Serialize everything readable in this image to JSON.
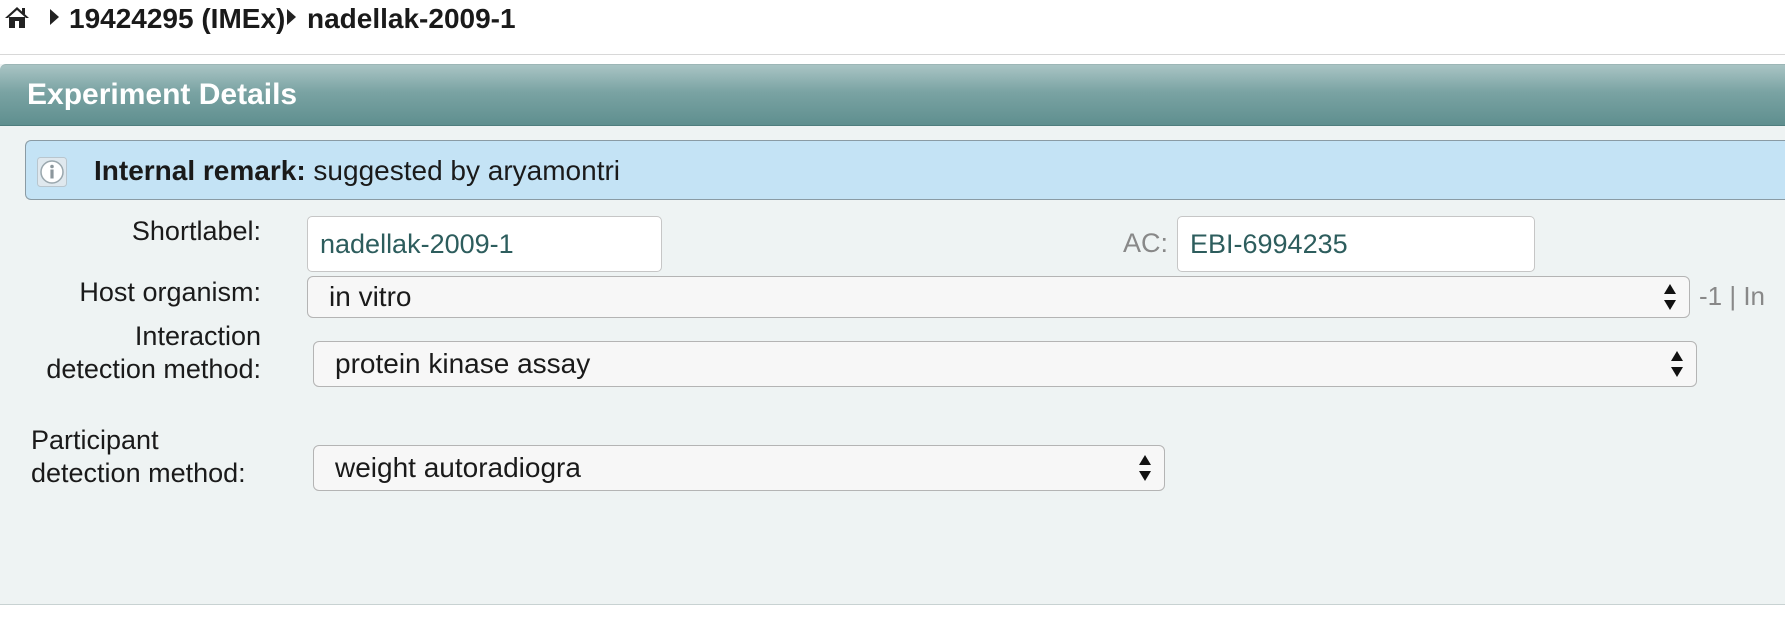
{
  "breadcrumb": {
    "home_icon": "home-icon",
    "items": [
      {
        "label": "19424295 (IMEx)"
      },
      {
        "label": "nadellak-2009-1"
      }
    ]
  },
  "panel": {
    "title": "Experiment Details",
    "remark": {
      "icon": "info-icon",
      "label": "Internal remark:",
      "text": "suggested by aryamontri"
    }
  },
  "form": {
    "shortlabel": {
      "label": "Shortlabel:",
      "value": "nadellak-2009-1"
    },
    "ac": {
      "label": "AC:",
      "value": "EBI-6994235"
    },
    "host_organism": {
      "label": "Host organism:",
      "value": "in vitro",
      "extra": "-1 | In"
    },
    "interaction_detection": {
      "label_line1": "Interaction",
      "label_line2": "detection method:",
      "value": "protein kinase assay"
    },
    "participant_detection": {
      "label_line1": "Participant",
      "label_line2": "detection method:",
      "value": "weight autoradiogra"
    }
  },
  "colors": {
    "header_gradient_top": "#a9c4c4",
    "header_gradient_bottom": "#5f8f8f",
    "remark_background": "#c4e3f5",
    "panel_background": "#eef3f3",
    "input_text": "#2d5d5d"
  }
}
